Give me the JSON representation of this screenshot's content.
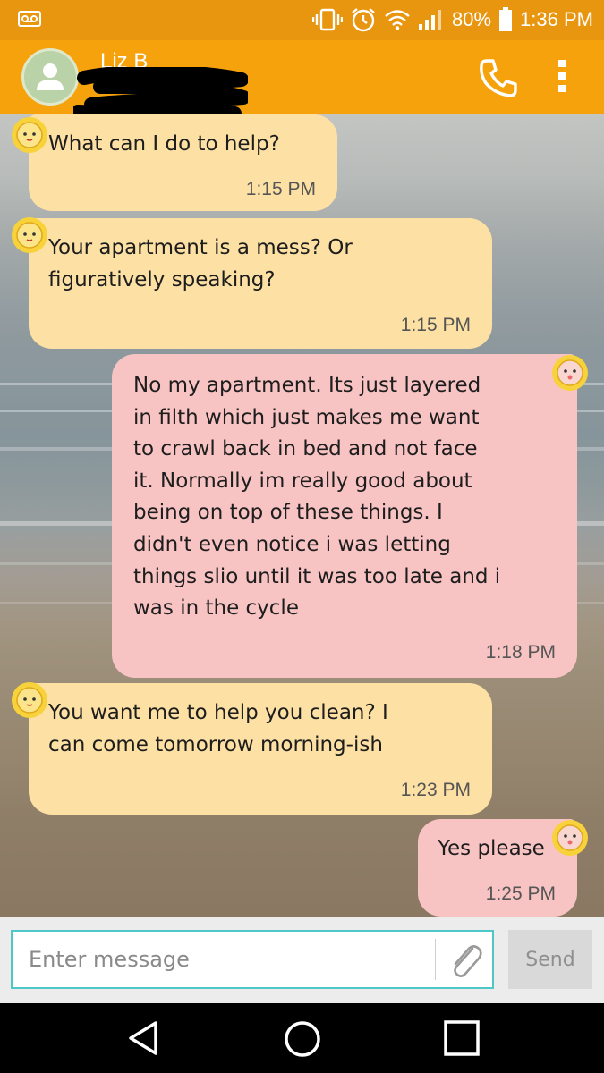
{
  "status_bar": {
    "battery": "80%",
    "time": "1:36 PM",
    "icons": [
      "voicemail-icon",
      "vibrate-icon",
      "alarm-icon",
      "wifi-icon",
      "signal-icon",
      "battery-icon"
    ]
  },
  "header": {
    "contact_name": "Liz B",
    "icons": [
      "avatar-icon",
      "phone-icon",
      "overflow-menu-icon"
    ]
  },
  "messages": [
    {
      "direction": "incoming",
      "text": "What can I do to help?",
      "time": "1:15 PM"
    },
    {
      "direction": "incoming",
      "text": "Your apartment is a mess? Or\nfiguratively speaking?",
      "time": "1:15 PM"
    },
    {
      "direction": "outgoing",
      "text": "No my apartment. Its just layered\nin filth which just makes me want\nto crawl back in bed and not face\nit. Normally im really good about\nbeing on top of these things. I\ndidn't even notice i was letting\nthings slio until it was too late and i\nwas in the cycle",
      "time": "1:18 PM"
    },
    {
      "direction": "incoming",
      "text": "You want me to help you clean?  I\ncan come tomorrow morning-ish",
      "time": "1:23 PM"
    },
    {
      "direction": "outgoing",
      "text": "Yes please",
      "time": "1:25 PM"
    }
  ],
  "composer": {
    "placeholder": "Enter message",
    "value": "",
    "send_label": "Send",
    "attach_icon": "paperclip-icon"
  },
  "nav_bar": {
    "icons": [
      "back-icon",
      "home-icon",
      "recents-icon"
    ]
  },
  "colors": {
    "status_bar": "#e8950f",
    "app_bar": "#f5a20c",
    "incoming_bubble": "#fde0a4",
    "outgoing_bubble": "#f7c3c3",
    "input_border": "#4fc7c7"
  }
}
